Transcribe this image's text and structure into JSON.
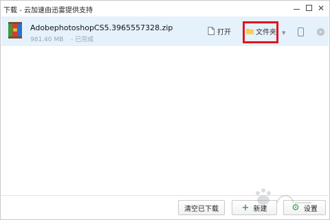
{
  "window": {
    "title": "下载 - 云加速由迅雷提供支持",
    "minimize_glyph": "—",
    "close_glyph": "✕"
  },
  "download": {
    "file_name": "AdobephotoshopCS5.3965557328.zip",
    "size": "981.40 MB",
    "status": "- 已完成",
    "open_label": "打开",
    "folder_label": "文件夹",
    "more_glyph": "▼",
    "cancel_glyph": "×"
  },
  "footer": {
    "clear_label": "清空已下载",
    "new_label": "新建",
    "settings_label": "设置",
    "plus_glyph": "+",
    "gear_glyph": "⚙"
  },
  "colors": {
    "row_highlight": "#e5f2fc",
    "annotation_red": "#e0141c",
    "accent_green": "#3aa655"
  },
  "icons": [
    "zip-archive-icon",
    "document-icon",
    "folder-icon",
    "phone-icon",
    "cancel-icon",
    "plus-icon",
    "gear-icon"
  ]
}
